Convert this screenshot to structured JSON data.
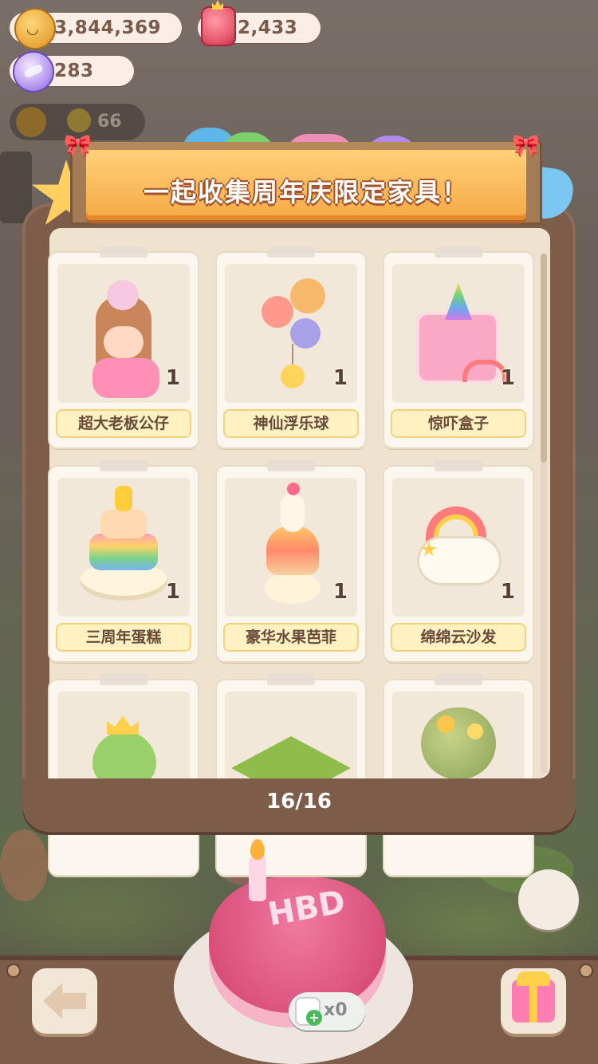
{
  "currencies": {
    "coins": "3,844,369",
    "gems": "2,433",
    "candy": "283",
    "hud_small": "66"
  },
  "banner": {
    "title": "一起收集周年庆限定家具！"
  },
  "items": [
    {
      "name": "超大老板公仔",
      "qty": "1"
    },
    {
      "name": "神仙浮乐球",
      "qty": "1"
    },
    {
      "name": "惊吓盒子",
      "qty": "1"
    },
    {
      "name": "三周年蛋糕",
      "qty": "1"
    },
    {
      "name": "豪华水果芭菲",
      "qty": "1"
    },
    {
      "name": "绵绵云沙发",
      "qty": "1"
    },
    {
      "name": "",
      "qty": ""
    },
    {
      "name": "",
      "qty": ""
    },
    {
      "name": "",
      "qty": ""
    }
  ],
  "pager": "16/16",
  "cake": {
    "decoration_text": "HBD",
    "count_label": "x0"
  },
  "icons": {
    "coin": "coin-icon",
    "gem": "gem-icon",
    "candy": "candy-icon",
    "back": "back-arrow-icon",
    "gift": "gift-icon"
  }
}
